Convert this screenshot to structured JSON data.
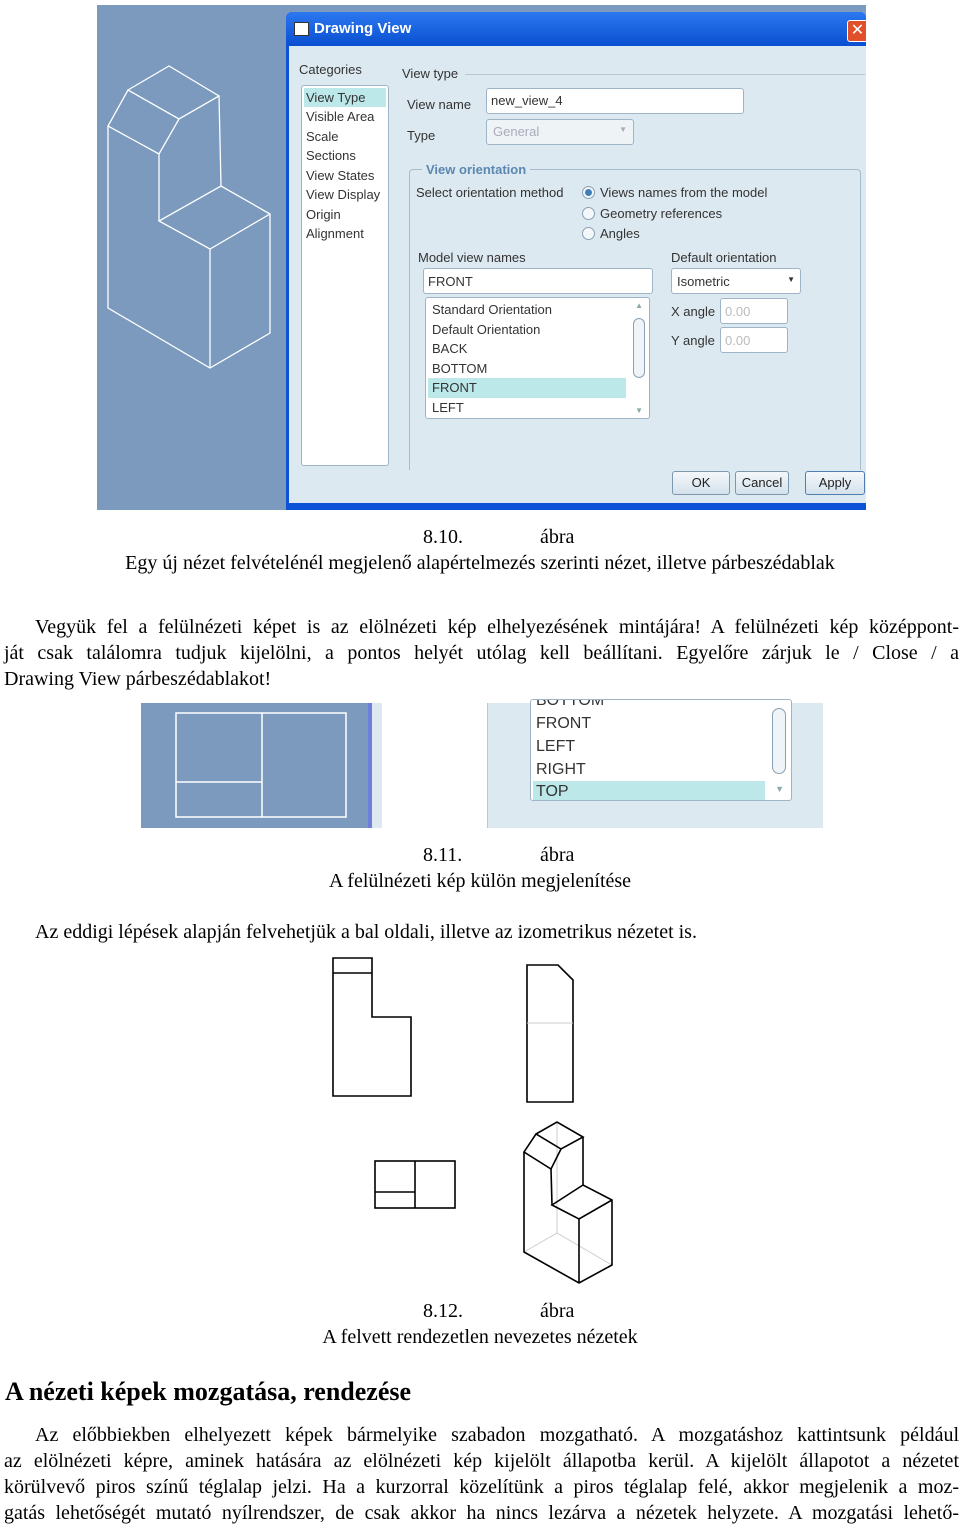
{
  "figure1": {
    "dialog": {
      "title": "Drawing View",
      "categories_label": "Categories",
      "categories": [
        "View Type",
        "Visible Area",
        "Scale",
        "Sections",
        "View States",
        "View Display",
        "Origin",
        "Alignment"
      ],
      "view_type_label": "View type",
      "view_name_label": "View name",
      "view_name_value": "new_view_4",
      "type_label": "Type",
      "type_value": "General",
      "view_orientation_label": "View orientation",
      "select_method_label": "Select orientation method",
      "methods": [
        "Views names from the model",
        "Geometry references",
        "Angles"
      ],
      "selected_method": "Views names from the model",
      "model_view_names_label": "Model view names",
      "model_view_name_value": "FRONT",
      "model_views": [
        "Standard Orientation",
        "Default Orientation",
        "BACK",
        "BOTTOM",
        "FRONT",
        "LEFT"
      ],
      "selected_model_view": "FRONT",
      "default_orientation_label": "Default orientation",
      "default_orientation_value": "Isometric",
      "x_angle_label": "X angle",
      "x_angle_value": "0.00",
      "y_angle_label": "Y angle",
      "y_angle_value": "0.00",
      "ok_label": "OK",
      "cancel_label": "Cancel",
      "apply_label": "Apply"
    },
    "number": "8.10.",
    "word": "ábra",
    "caption": "Egy új nézet felvételénél megjelenő alapértelmezés szerinti nézet, illetve párbeszédablak"
  },
  "paragraph1": [
    "Vegyük fel a felülnézeti képet is az elölnézeti kép elhelyezésének mintájára! A felülnézeti kép középpont-",
    "ját csak találomra tudjuk kijelölni, a pontos helyét utólag kell beállítani. Egyelőre zárjuk le / Close / a",
    "Drawing View párbeszédablakot!"
  ],
  "figure2": {
    "list_items": [
      "BOTTOM",
      "FRONT",
      "LEFT",
      "RIGHT",
      "TOP"
    ],
    "selected": "TOP",
    "number": "8.11.",
    "word": "ábra",
    "caption": "A felülnézeti kép külön megjelenítése"
  },
  "paragraph2": "Az eddigi lépések alapján felvehetjük a bal oldali, illetve az izometrikus nézetet is.",
  "figure3": {
    "number": "8.12.",
    "word": "ábra",
    "caption": "A felvett rendezetlen nevezetes nézetek"
  },
  "section_heading": "A nézeti képek mozgatása, rendezése",
  "paragraph3": [
    "Az előbbiekben elhelyezett képek bármelyike szabadon mozgatható. A mozgatáshoz kattintsunk például",
    "az elölnézeti képre, aminek  hatására az elölnézeti kép kijelölt állapotba kerül. A kijelölt állapotot a nézetet",
    "körülvevő piros színű téglalap jelzi. Ha a kurzorral közelítünk a piros téglalap felé, akkor megjelenik a moz-",
    "gatás lehetőségét mutató nyílrendszer, de csak akkor ha nincs lezárva a nézetek helyzete. A mozgatási lehető-"
  ],
  "colors": {
    "model_bg": "#7b9abe",
    "titlebar": "#0a52d6",
    "dialog_bg": "#dde9f1",
    "selection": "#bde8ea",
    "close": "#e0502a"
  }
}
